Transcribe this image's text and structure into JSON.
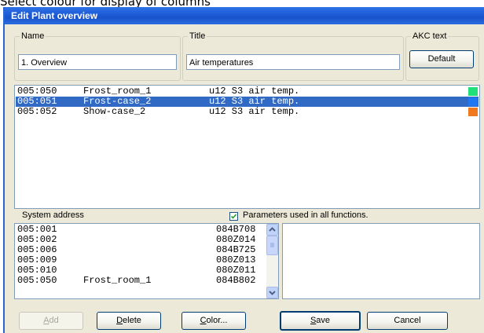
{
  "caption": "Select colour for display of columns",
  "window": {
    "title": "Edit Plant overview"
  },
  "name_group": {
    "legend": "Name",
    "value": "1. Overview"
  },
  "title_group": {
    "legend": "Title",
    "value": "Air temperatures"
  },
  "akc_group": {
    "legend": "AKC text",
    "button": "Default"
  },
  "points": [
    {
      "addr": "005:050",
      "name": "Frost_room_1",
      "param": "u12 S3 air temp.",
      "color": "#21e07a",
      "selected": false
    },
    {
      "addr": "005:051",
      "name": "Frost-case_2",
      "param": "u12 S3 air temp.",
      "color": "#1f78f2",
      "selected": true
    },
    {
      "addr": "005:052",
      "name": "Show-case_2",
      "param": "u12 S3 air temp.",
      "color": "#f07a20",
      "selected": false
    }
  ],
  "system_address_label": "System address",
  "params_check": {
    "label": "Parameters used in all functions.",
    "checked": true
  },
  "addresses": [
    {
      "addr": "005:001",
      "name": "",
      "code": "084B708"
    },
    {
      "addr": "005:002",
      "name": "",
      "code": "080Z014"
    },
    {
      "addr": "005:006",
      "name": "",
      "code": "084B725"
    },
    {
      "addr": "005:009",
      "name": "",
      "code": "080Z013"
    },
    {
      "addr": "005:010",
      "name": "",
      "code": "080Z011"
    },
    {
      "addr": "005:050",
      "name": "Frost_room_1",
      "code": "084B802"
    }
  ],
  "buttons": {
    "add": {
      "letter": "A",
      "rest": "dd"
    },
    "delete": {
      "letter": "D",
      "rest": "elete"
    },
    "color": {
      "letter": "C",
      "rest": "olor..."
    },
    "save": {
      "letter": "S",
      "rest": "ave"
    },
    "cancel": "Cancel"
  },
  "icons": {
    "check": "check-icon",
    "up": "scroll-up-arrow-icon",
    "down": "scroll-down-arrow-icon"
  }
}
